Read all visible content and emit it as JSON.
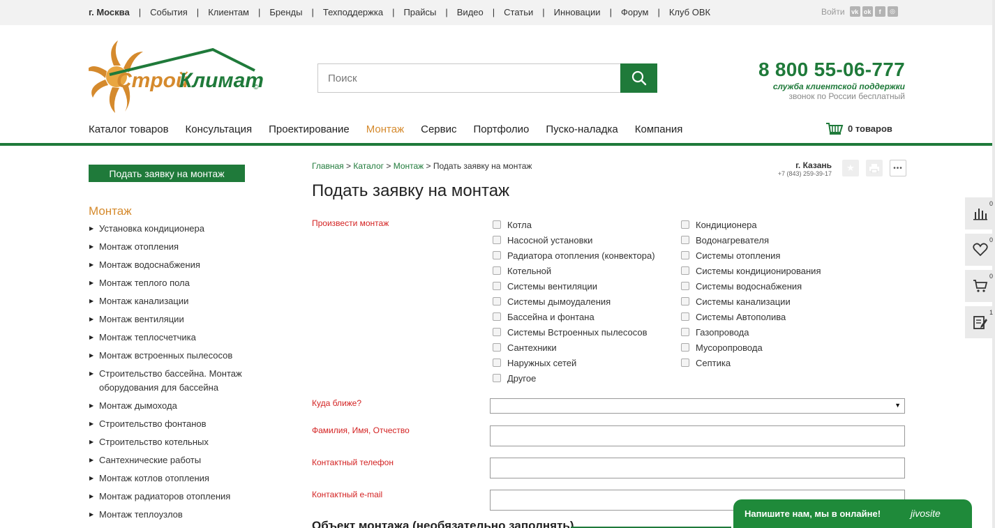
{
  "topbar": {
    "city": "г. Москва",
    "links": [
      "События",
      "Клиентам",
      "Бренды",
      "Техподдержка",
      "Прайсы",
      "Видео",
      "Статьи",
      "Инновации",
      "Форум",
      "Клуб ОВК"
    ],
    "login": "Войти",
    "social": [
      "vk-icon",
      "odnoklassniki-icon",
      "facebook-icon",
      "instagram-icon"
    ]
  },
  "logo": {
    "text1": "Строй",
    "text2": "Климат",
    "mark": "©"
  },
  "search": {
    "placeholder": "Поиск"
  },
  "phone": {
    "number": "8 800 55-06-777",
    "line1": "служба клиентской поддержки",
    "line2": "звонок по России бесплатный"
  },
  "mainnav": [
    "Каталог товаров",
    "Консультация",
    "Проектирование",
    "Монтаж",
    "Сервис",
    "Портфолио",
    "Пуско-наладка",
    "Компания"
  ],
  "cart": {
    "label": "0 товаров"
  },
  "sidebar": {
    "button": "Подать заявку на монтаж",
    "title": "Монтаж",
    "items": [
      "Установка кондиционера",
      "Монтаж отопления",
      "Монтаж водоснабжения",
      "Монтаж теплого пола",
      "Монтаж канализации",
      "Монтаж вентиляции",
      "Монтаж теплосчетчика",
      "Монтаж встроенных пылесосов",
      "Строительство бассейна. Монтаж оборудования для бассейна",
      "Монтаж дымохода",
      "Строительство фонтанов",
      "Строительство котельных",
      "Сантехнические работы",
      "Монтаж котлов отопления",
      "Монтаж радиаторов отопления",
      "Монтаж теплоузлов"
    ]
  },
  "breadcrumb": {
    "items": [
      "Главная",
      "Каталог",
      "Монтаж"
    ],
    "current": "Подать заявку на монтаж",
    "sep": " > "
  },
  "page_title": "Подать заявку на монтаж",
  "location": {
    "city": "г. Казань",
    "phone": "+7 (843) 259-39-17"
  },
  "tools": {
    "more": "•••"
  },
  "form": {
    "install_label": "Произвести монтаж",
    "col1": [
      "Котла",
      "Насосной установки",
      "Радиатора отопления (конвектора)",
      "Котельной",
      "Системы вентиляции",
      "Системы дымоудаления",
      "Бассейна и фонтана",
      "Системы Встроенных пылесосов",
      "Сантехники",
      "Наружных сетей",
      "Другое"
    ],
    "col2": [
      "Кондиционера",
      "Водонагревателя",
      "Системы отопления",
      "Системы кондиционирования",
      "Системы водоснабжения",
      "Системы канализации",
      "Системы Автополива",
      "Газопровода",
      "Мусоропровода",
      "Септика"
    ],
    "where_label": "Куда ближе?",
    "where_value": "",
    "name_label": "Фамилия, Имя, Отчество",
    "phone_label": "Контактный телефон",
    "email_label": "Контактный e-mail",
    "object_heading": "Объект монтажа (необязательно заполнять)"
  },
  "right_panel": {
    "compare_count": "0",
    "favorites_count": "0",
    "cart_count": "0",
    "orders_count": "1"
  },
  "chat": {
    "text": "Напишите нам, мы в онлайне!",
    "brand": "jivosite"
  },
  "colors": {
    "brand_green": "#1f7a3a",
    "accent_orange": "#d58a2d",
    "required_red": "#d32222"
  }
}
